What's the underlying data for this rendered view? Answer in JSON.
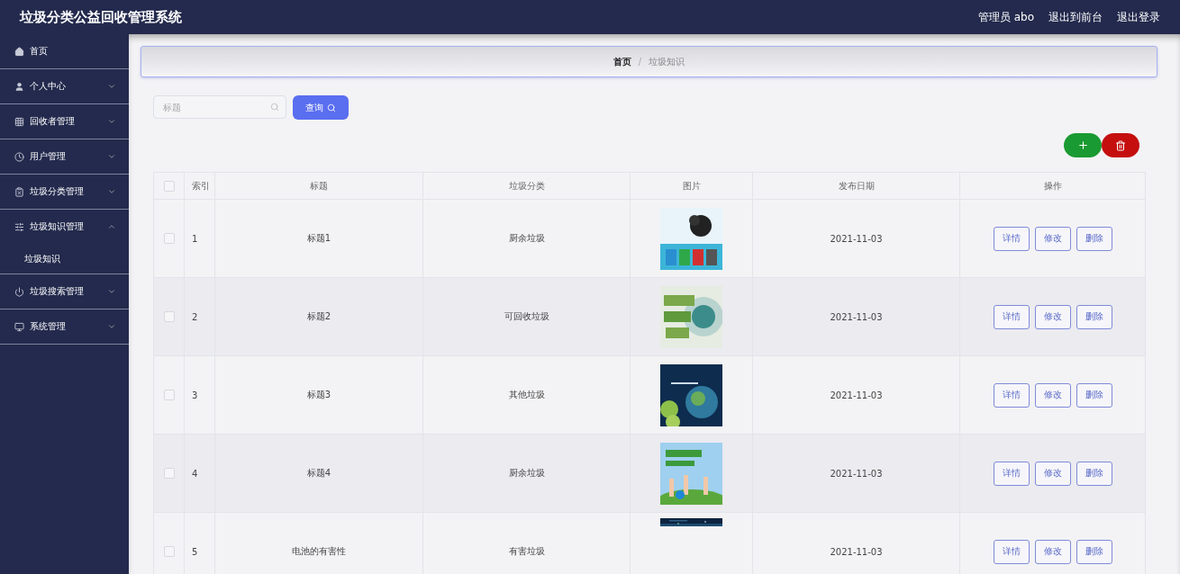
{
  "header": {
    "title": "垃圾分类公益回收管理系统",
    "user": "管理员 abo",
    "links": [
      "退出到前台",
      "退出登录"
    ]
  },
  "sidebar": {
    "items": [
      {
        "label": "首页",
        "kind": "link"
      },
      {
        "label": "个人中心",
        "kind": "menu",
        "expanded": false
      },
      {
        "label": "回收者管理",
        "kind": "menu",
        "expanded": false
      },
      {
        "label": "用户管理",
        "kind": "menu",
        "expanded": false
      },
      {
        "label": "垃圾分类管理",
        "kind": "menu",
        "expanded": false
      },
      {
        "label": "垃圾知识管理",
        "kind": "menu",
        "expanded": true,
        "children": [
          {
            "label": "垃圾知识"
          }
        ]
      },
      {
        "label": "垃圾搜索管理",
        "kind": "menu",
        "expanded": false
      },
      {
        "label": "系统管理",
        "kind": "menu",
        "expanded": false
      }
    ]
  },
  "breadcrumb": [
    "首页",
    "/",
    "垃圾知识"
  ],
  "search": {
    "placeholder": "标题",
    "button": "查询"
  },
  "table": {
    "columns": [
      "索引",
      "标题",
      "垃圾分类",
      "图片",
      "发布日期",
      "操作"
    ],
    "all_checked": false,
    "rows": [
      {
        "index": "1",
        "title": "标题1",
        "category": "厨余垃圾",
        "date": "2021-11-03",
        "checked": false,
        "actions": [
          "详情",
          "修改",
          "删除"
        ]
      },
      {
        "index": "2",
        "title": "标题2",
        "category": "可回收垃圾",
        "date": "2021-11-03",
        "checked": false,
        "actions": [
          "详情",
          "修改",
          "删除"
        ]
      },
      {
        "index": "3",
        "title": "标题3",
        "category": "其他垃圾",
        "date": "2021-11-03",
        "checked": false,
        "actions": [
          "详情",
          "修改",
          "删除"
        ]
      },
      {
        "index": "4",
        "title": "标题4",
        "category": "厨余垃圾",
        "date": "2021-11-03",
        "checked": false,
        "actions": [
          "详情",
          "修改",
          "删除"
        ]
      },
      {
        "index": "5",
        "title": "电池的有害性",
        "category": "有害垃圾",
        "image": {
          "kind": "strip"
        },
        "date": "2021-11-03",
        "checked": false,
        "actions": [
          "详情",
          "修改",
          "删除"
        ]
      }
    ]
  }
}
